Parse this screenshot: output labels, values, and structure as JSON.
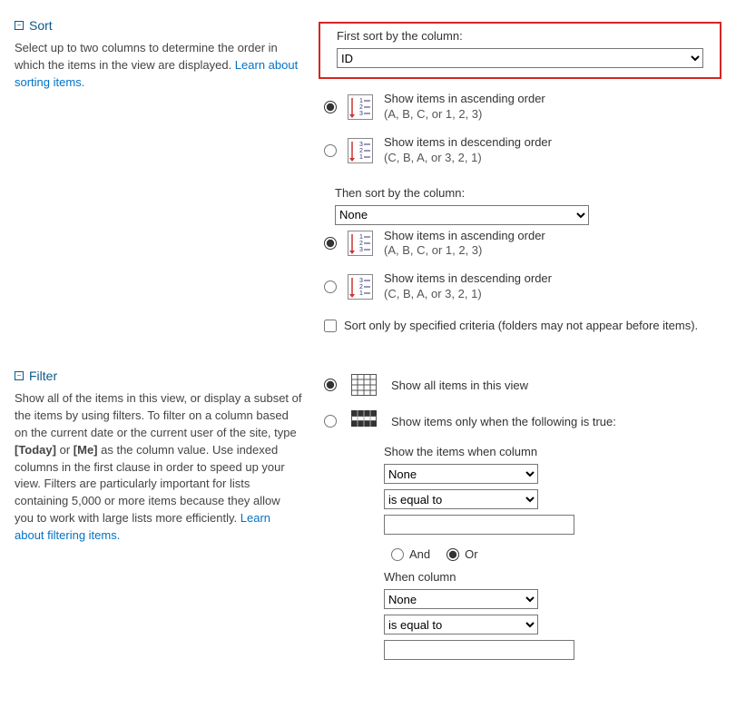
{
  "sort": {
    "title": "Sort",
    "desc": "Select up to two columns to determine the order in which the items in the view are displayed. ",
    "learn_link": "Learn about sorting items.",
    "first_label": "First sort by the column:",
    "first_value": "ID",
    "asc_label": "Show items in ascending order",
    "asc_sub": "(A, B, C, or 1, 2, 3)",
    "desc_label": "Show items in descending order",
    "desc_sub": "(C, B, A, or 3, 2, 1)",
    "then_label": "Then sort by the column:",
    "then_value": "None",
    "check_label": "Sort only by specified criteria (folders may not appear before items)."
  },
  "filter": {
    "title": "Filter",
    "desc_a": "Show all of the items in this view, or display a subset of the items by using filters. To filter on a column based on the current date or the current user of the site, type ",
    "today": "[Today]",
    "or": " or ",
    "me": "[Me]",
    "desc_b": " as the column value. Use indexed columns in the first clause in order to speed up your view. Filters are particularly important for lists containing 5,000 or more items because they allow you to work with large lists more efficiently. ",
    "learn_link": "Learn about filtering items.",
    "opt_all": "Show all items in this view",
    "opt_when": "Show items only when the following is true:",
    "show_when": "Show the items when column",
    "col_value": "None",
    "op_value": "is equal to",
    "and": "And",
    "orlabel": "Or",
    "when_col": "When column",
    "col2_value": "None",
    "op2_value": "is equal to"
  }
}
